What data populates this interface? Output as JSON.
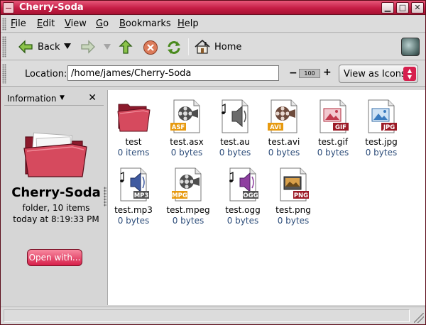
{
  "window": {
    "title": "Cherry-Soda"
  },
  "menu": {
    "items": [
      {
        "label": "File"
      },
      {
        "label": "Edit"
      },
      {
        "label": "View"
      },
      {
        "label": "Go"
      },
      {
        "label": "Bookmarks"
      },
      {
        "label": "Help"
      }
    ]
  },
  "toolbar": {
    "back_label": "Back",
    "home_label": "Home"
  },
  "location": {
    "label": "Location:",
    "path": "/home/james/Cherry-Soda",
    "zoom": "100",
    "view_mode": "View as Icons"
  },
  "sidepane": {
    "panel_title": "Information",
    "folder_name": "Cherry-Soda",
    "folder_summary": "folder, 10 items",
    "modified": "today at 8:19:33 PM",
    "open_with_label": "Open with..."
  },
  "files": [
    {
      "name": "test",
      "size": "0 items",
      "badge": "",
      "kind": "folder"
    },
    {
      "name": "test.asx",
      "size": "0 bytes",
      "badge": "ASF",
      "kind": "video",
      "badge_color": "#e79a10"
    },
    {
      "name": "test.au",
      "size": "0 bytes",
      "badge": "",
      "kind": "audio"
    },
    {
      "name": "test.avi",
      "size": "0 bytes",
      "badge": "AVI",
      "kind": "video",
      "badge_color": "#e79a10"
    },
    {
      "name": "test.gif",
      "size": "0 bytes",
      "badge": "GIF",
      "kind": "image",
      "badge_color": "#9c1a26"
    },
    {
      "name": "test.jpg",
      "size": "0 bytes",
      "badge": "JPG",
      "kind": "image",
      "badge_color": "#9c1a26"
    },
    {
      "name": "test.mp3",
      "size": "0 bytes",
      "badge": "MP3",
      "kind": "audio",
      "badge_color": "#555555"
    },
    {
      "name": "test.mpeg",
      "size": "0 bytes",
      "badge": "MPG",
      "kind": "video",
      "badge_color": "#e79a10"
    },
    {
      "name": "test.ogg",
      "size": "0 bytes",
      "badge": "OGG",
      "kind": "audio",
      "badge_color": "#555555"
    },
    {
      "name": "test.png",
      "size": "0 bytes",
      "badge": "PNG",
      "kind": "image",
      "badge_color": "#9c1a26"
    }
  ],
  "colors": {
    "accent": "#c51d45",
    "link_text": "#2d4d7a"
  }
}
